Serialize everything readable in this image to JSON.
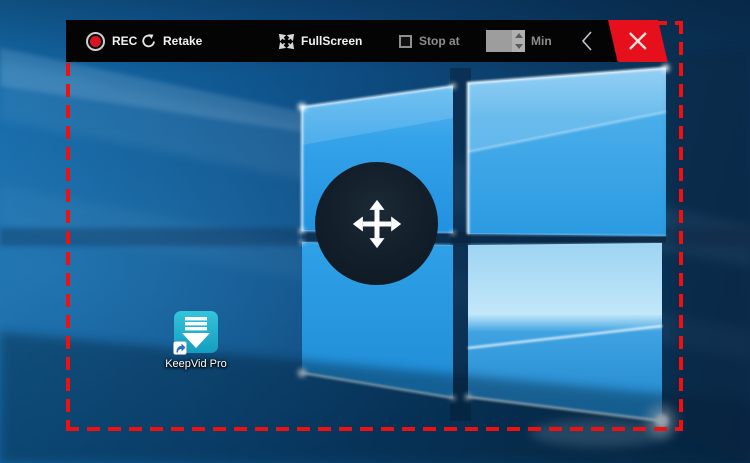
{
  "toolbar": {
    "rec_label": "REC",
    "retake_label": "Retake",
    "fullscreen_label": "FullScreen",
    "stop_at_label": "Stop at",
    "stop_at_checked": false,
    "minutes_value": "",
    "min_label": "Min"
  },
  "desktop": {
    "icon_label": "KeepVid Pro"
  },
  "region": {
    "border_color": "#ee1111",
    "border_style": "dashed"
  },
  "icons": {
    "record": "red-record-dot",
    "retake": "circular-refresh-arrow",
    "fullscreen": "expand-arrows",
    "stop_at": "checkbox-unchecked",
    "minutes": "up-down-spinner",
    "collapse": "chevron-left",
    "close": "x-mark",
    "handle": "four-way-move-arrows",
    "keepvid": "download-arrow-teal"
  },
  "colors": {
    "toolbar_bg": "#040404",
    "close_button_bg": "#e60f1c",
    "record_red": "#d81425",
    "active_text": "#f2f2f2",
    "disabled_text": "#8d8d8d",
    "icon_teal": "#1fadc9"
  }
}
